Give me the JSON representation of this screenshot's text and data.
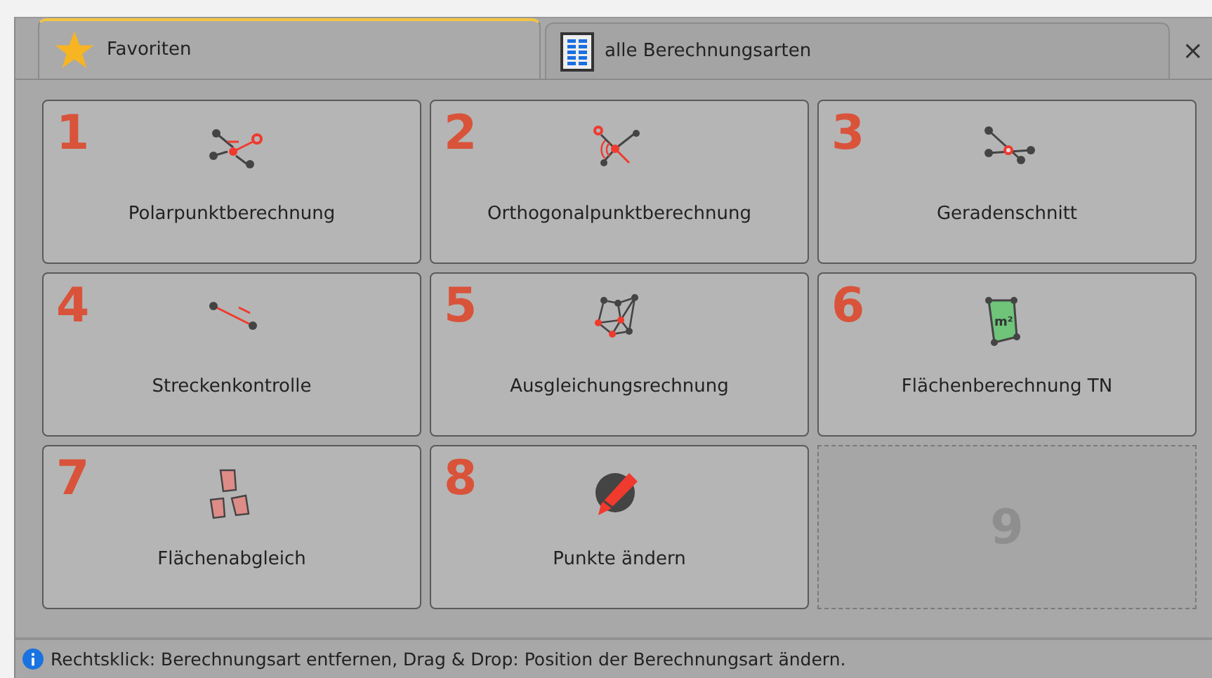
{
  "tabs": [
    {
      "label": "Favoriten",
      "selected": true
    },
    {
      "label": "alle Berechnungsarten",
      "selected": false
    }
  ],
  "close": "×",
  "tiles": [
    {
      "kind": "calculation",
      "number": "1",
      "label": "Polarpunktberechnung"
    },
    {
      "kind": "calculation",
      "number": "2",
      "label": "Orthogonalpunktberechnung"
    },
    {
      "kind": "calculation",
      "number": "3",
      "label": "Geradenschnitt"
    },
    {
      "kind": "calculation",
      "number": "4",
      "label": "Streckenkontrolle"
    },
    {
      "kind": "calculation",
      "number": "5",
      "label": "Ausgleichungsrechnung"
    },
    {
      "kind": "calculation",
      "number": "6",
      "label": "Flächenberechnung TN",
      "icon_text": "m²"
    },
    {
      "kind": "calculation",
      "number": "7",
      "label": "Flächenabgleich"
    },
    {
      "kind": "calculation",
      "number": "8",
      "label": "Punkte ändern"
    },
    {
      "kind": "empty",
      "number": "9"
    }
  ],
  "status_bar": "Rechtsklick: Berechnungsart entfernen, Drag & Drop: Position der Berechnungsart ändern."
}
